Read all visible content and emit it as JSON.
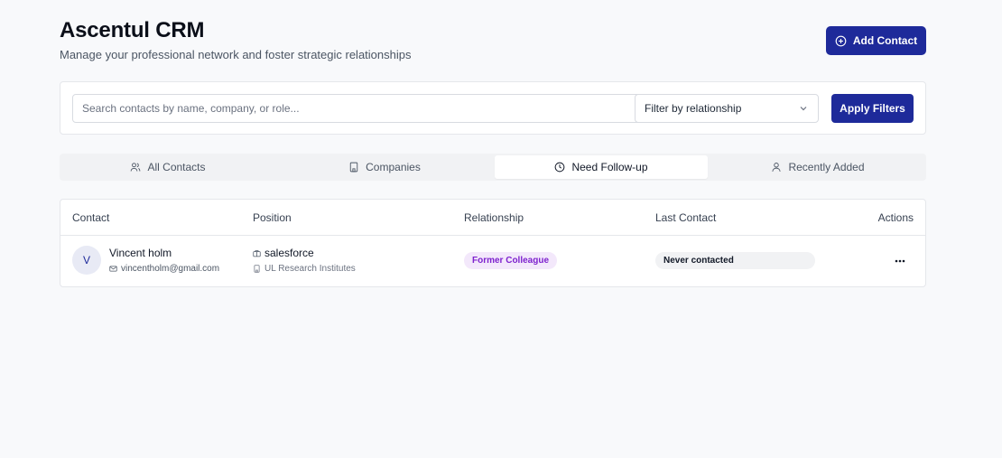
{
  "header": {
    "title": "Ascentul CRM",
    "subtitle": "Manage your professional network and foster strategic relationships",
    "add_contact_label": "Add Contact"
  },
  "filters": {
    "search_placeholder": "Search contacts by name, company, or role...",
    "search_value": "",
    "relationship_selected": "Filter by relationship",
    "apply_label": "Apply Filters"
  },
  "tabs": [
    {
      "label": "All Contacts",
      "icon": "users-icon",
      "active": false
    },
    {
      "label": "Companies",
      "icon": "building-icon",
      "active": false
    },
    {
      "label": "Need Follow-up",
      "icon": "clock-icon",
      "active": true
    },
    {
      "label": "Recently Added",
      "icon": "user-icon",
      "active": false
    }
  ],
  "table": {
    "columns": [
      "Contact",
      "Position",
      "Relationship",
      "Last Contact",
      "Actions"
    ],
    "rows": [
      {
        "initial": "V",
        "name": "Vincent holm",
        "email": "vincentholm@gmail.com",
        "position": "salesforce",
        "company": "UL Research Institutes",
        "relationship": "Former Colleague",
        "last_contact": "Never contacted"
      }
    ]
  },
  "colors": {
    "primary": "#1e2a9a",
    "relationship_badge_bg": "#f3e8fb",
    "relationship_badge_text": "#7e22ce",
    "page_bg": "#f8f9fb"
  }
}
